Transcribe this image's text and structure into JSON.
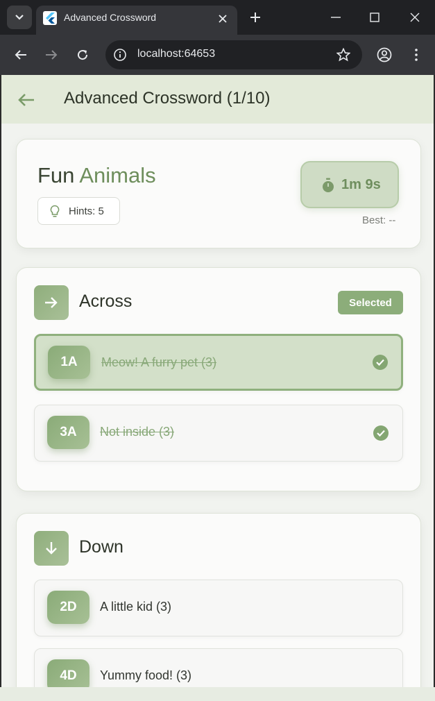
{
  "browser": {
    "tab_title": "Advanced Crossword",
    "url": "localhost:64653"
  },
  "appbar": {
    "title": "Advanced Crossword (1/10)"
  },
  "puzzle": {
    "title_prefix": "Fun ",
    "title_accent": "Animals",
    "hints_label": "Hints: 5",
    "timer": "1m 9s",
    "best": "Best: --"
  },
  "across": {
    "title": "Across",
    "badge": "Selected",
    "clues": [
      {
        "num": "1A",
        "text": "Meow! A furry pet (3)",
        "solved": true,
        "active": true
      },
      {
        "num": "3A",
        "text": "Not inside (3)",
        "solved": true,
        "active": false
      }
    ]
  },
  "down": {
    "title": "Down",
    "clues": [
      {
        "num": "2D",
        "text": "A little kid (3)",
        "solved": false
      },
      {
        "num": "4D",
        "text": "Yummy food! (3)",
        "solved": false
      }
    ]
  },
  "colors": {
    "accent": "#8cad7a",
    "accent_dark": "#6e8e5c",
    "appbar_bg": "#e3ead9"
  }
}
